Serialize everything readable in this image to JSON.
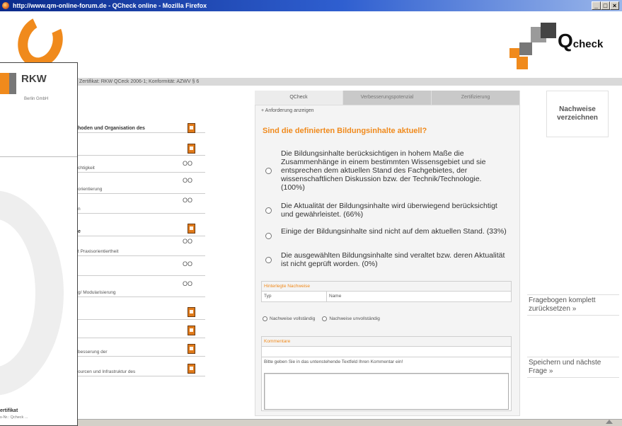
{
  "window": {
    "title": "http://www.qm-online-forum.de - QCheck online - Mozilla Firefox",
    "controls": [
      "_",
      "□",
      "×"
    ]
  },
  "brand": {
    "qcheck_text": "Q",
    "qcheck_small": "check",
    "orange": "#f08a1c",
    "grey": "#777777"
  },
  "info_bar": "Zertifikat: RKW QCeck 2006-1; Konformität: AZWV § 6",
  "tabs": [
    "QCheck",
    "Verbesserungspotenzial",
    "Zertifizierung"
  ],
  "center": {
    "req_link": "+ Anforderung anzeigen",
    "question": "Sind die definierten Bildungsinhalte aktuell?",
    "answers": [
      "Die Bildungsinhalte berücksichtigen in hohem Maße die Zusammenhänge in einem bestimmten Wissensgebiet und sie entsprechen dem aktuellen Stand des Fachgebietes, der wissenschaftlichen Diskussion bzw. der Technik/Technologie. (100%)",
      "Die Aktualität der Bildungsinhalte wird überwiegend berücksichtigt und gewährleistet. (66%)",
      "Einige der Bildungsinhalte sind nicht auf dem aktuellen Stand. (33%)",
      "Die ausgewählten Bildungsinhalte sind veraltet bzw. deren Aktualität ist nicht geprüft worden. (0%)"
    ],
    "evidence_header": "Hinterlegte Nachweise",
    "evidence_col_type": "Typ",
    "evidence_col_name": "Name",
    "radio_complete": "Nachweise vollständig",
    "radio_incomplete": "Nachweise unvollständig",
    "comment_header": "Kommentare",
    "comment_hint": "Bitte geben Sie in das untenstehende Textfeld Ihren Kommentar ein!"
  },
  "right": {
    "card": "Nachweise verzeichnen",
    "reset_link": "Fragebogen komplett zurücksetzen »",
    "save_link": "Speichern und nächste Frage »"
  },
  "left": {
    "criteria": [
      {
        "label": "hoden und Organisation des",
        "bold": true,
        "marker": "doc"
      },
      {
        "label": "",
        "bold": false,
        "marker": "doc"
      },
      {
        "label": "chtigkeit",
        "bold": false,
        "marker": "oo"
      },
      {
        "label": "orientierung",
        "bold": false,
        "marker": "oo"
      },
      {
        "label": "n",
        "bold": false,
        "marker": "oo"
      },
      {
        "label": "e",
        "bold": true,
        "marker": "doc"
      },
      {
        "label": "t Praxisorientiertheit",
        "bold": false,
        "marker": "oo"
      },
      {
        "label": "",
        "bold": false,
        "marker": "oo"
      },
      {
        "label": "g/ Modularisierung",
        "bold": false,
        "marker": "oo"
      },
      {
        "label": "",
        "bold": false,
        "marker": "doc"
      },
      {
        "label": "",
        "bold": false,
        "marker": "doc"
      },
      {
        "label": "besserung der",
        "bold": false,
        "marker": "doc"
      },
      {
        "label": "ourcen und Infrastruktur des",
        "bold": false,
        "marker": "doc"
      }
    ],
    "oo_text": "OO"
  },
  "rkw": {
    "name": "RKW",
    "subtitle": "Berlin GmbH",
    "cert": "ertifikat",
    "cert_sub": "s-Nr.: Qcheck ..."
  }
}
